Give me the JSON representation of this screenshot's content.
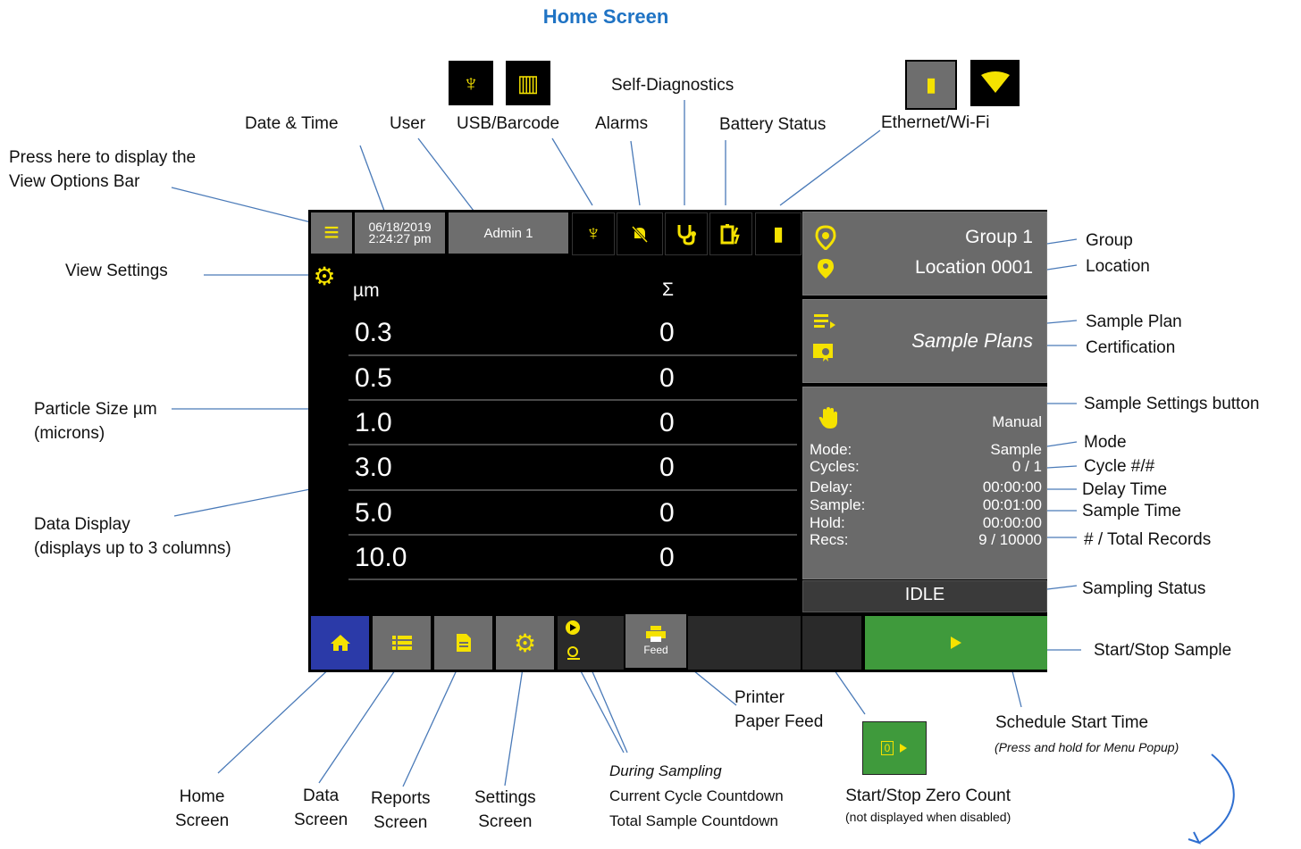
{
  "page_title": "Home Screen",
  "top_icons": {
    "usb_glyph": "♆",
    "barcode_glyph": "▥",
    "ethernet_glyph": "▮",
    "wifi_glyph": "▼"
  },
  "device": {
    "menu_icon": "≡",
    "date": "06/18/2019",
    "time": "2:24:27 pm",
    "user": "Admin 1",
    "header_size": "µm",
    "header_sum": "Σ",
    "rows": [
      {
        "size": "0.3",
        "count": "0"
      },
      {
        "size": "0.5",
        "count": "0"
      },
      {
        "size": "1.0",
        "count": "0"
      },
      {
        "size": "3.0",
        "count": "0"
      },
      {
        "size": "5.0",
        "count": "0"
      },
      {
        "size": "10.0",
        "count": "0"
      }
    ],
    "group": "Group 1",
    "location": "Location 0001",
    "sample_plans": "Sample Plans",
    "mode_value": "Manual",
    "settings": [
      {
        "label": "Mode:",
        "value": "Sample"
      },
      {
        "label": "Cycles:",
        "value": "0 / 1"
      },
      {
        "label": "Delay:",
        "value": "00:00:00"
      },
      {
        "label": "Sample:",
        "value": "00:01:00"
      },
      {
        "label": "Hold:",
        "value": "00:00:00"
      },
      {
        "label": "Recs:",
        "value": "9 / 10000"
      }
    ],
    "status": "IDLE",
    "feed_label": "Feed",
    "zero_count_glyph": "0"
  },
  "labels": {
    "press_here": [
      "Press here to display the",
      "View Options Bar"
    ],
    "date_time": "Date & Time",
    "user": "User",
    "usb_barcode": "USB/Barcode",
    "alarms": "Alarms",
    "self_diagnostics": "Self-Diagnostics",
    "battery_status": "Battery Status",
    "ethernet_wifi": "Ethernet/Wi-Fi",
    "view_settings": "View Settings",
    "particle_size": [
      "Particle Size µm",
      "(microns)"
    ],
    "data_display": [
      "Data Display",
      "(displays up to 3 columns)"
    ],
    "group": "Group",
    "location": "Location",
    "sample_plan": "Sample Plan",
    "certification": "Certification",
    "sample_settings_button": "Sample Settings button",
    "mode": "Mode",
    "cycle": "Cycle #/#",
    "delay_time": "Delay Time",
    "sample_time": "Sample Time",
    "total_records": "# / Total Records",
    "sampling_status": "Sampling Status",
    "start_stop_sample": "Start/Stop Sample",
    "printer_paper_feed": [
      "Printer",
      "Paper Feed"
    ],
    "schedule_start_time": "Schedule Start Time",
    "schedule_note": "(Press and hold for Menu Popup)",
    "home_screen": [
      "Home",
      "Screen"
    ],
    "data_screen": [
      "Data",
      "Screen"
    ],
    "reports_screen": [
      "Reports",
      "Screen"
    ],
    "settings_screen": [
      "Settings",
      "Screen"
    ],
    "during_sampling": "During Sampling",
    "current_cycle": "Current Cycle Countdown",
    "total_sample": "Total Sample Countdown",
    "zero_count": "Start/Stop Zero Count",
    "zero_note": "(not displayed when disabled)"
  },
  "colors": {
    "accent_yellow": "#f5e200",
    "start_green": "#3f9a3c",
    "home_blue": "#2b3aa8",
    "title_blue": "#1f73c4"
  }
}
